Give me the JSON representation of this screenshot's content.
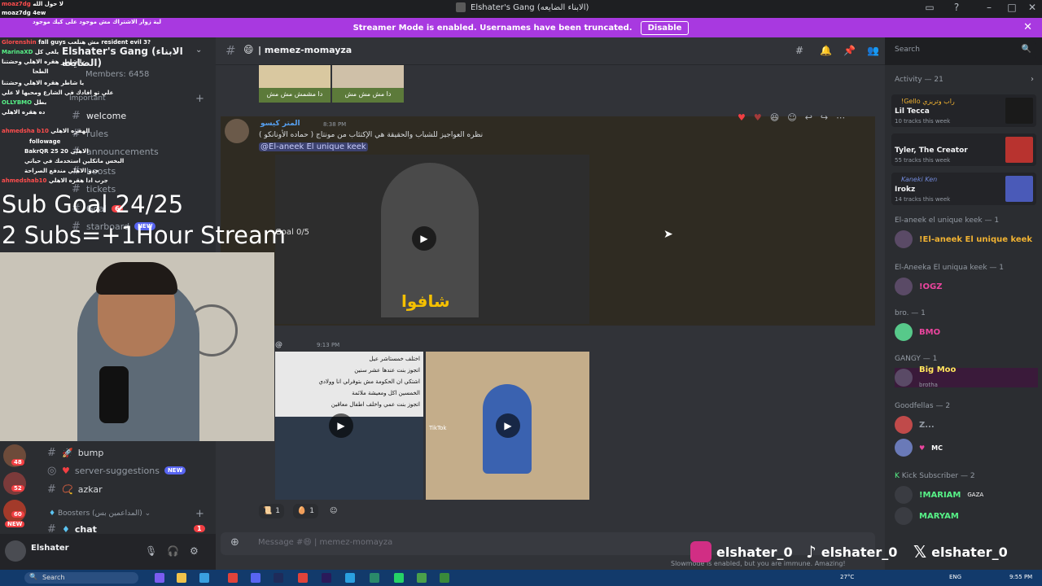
{
  "window": {
    "title": "Elshater's Gang (الابناء الضايعه)"
  },
  "banner": {
    "text": "Streamer Mode is enabled. Usernames have been truncated.",
    "button": "Disable"
  },
  "server": {
    "name": "Elshater's Gang (الابناء الضايعه)",
    "members": "Members: 6458",
    "important": "Important",
    "channels_top": [
      "welcome",
      "rules",
      "announcements",
      "boosts",
      "tickets",
      "Goal",
      "starboard"
    ],
    "new_badge": "NEW",
    "badge_6": "6",
    "channels_bottom": [
      {
        "name": "bump"
      },
      {
        "name": "server-suggestions",
        "badge": "NEW"
      },
      {
        "name": "azkar"
      }
    ],
    "boosters_category": "Boosters (المداعمين بس)",
    "chat_channel": "chat",
    "chat_badge": "1",
    "server_badges": [
      "749",
      "14",
      "48",
      "52",
      "60",
      "NEW"
    ]
  },
  "user": {
    "name": "Elshater"
  },
  "channel": {
    "name": "memez-momayza",
    "emoji": "😄"
  },
  "search": {
    "placeholder": "Search"
  },
  "messages": {
    "top_images": [
      "دا مشمش مش مش",
      "دا مش مش مش"
    ],
    "m1": {
      "author": "المتر كيسو",
      "time": "8:38 PM",
      "text": "نظره العواجيز للشباب والحقيقة هي الإكتئاب من مونتاج ( حماده الأونانكو )",
      "mention": "@El-aneek El unique keek",
      "video_caption": "شافوا",
      "video_overlay": "Goal 0/5"
    },
    "m2": {
      "author": "@",
      "time": "9:13 PM",
      "image1_lines": [
        "اختلف خمستاشر عيل",
        "اتجوز بنت عندها عشر سنين",
        "اشتكي ان الحكومة مش بتوفرلي انا وولادي",
        "الخمسين اكل ومعيشة ملائمة",
        "اتجوز بنت عمي واخلف اطفال معاقين"
      ],
      "image2_label": "TikTok"
    },
    "reactions": [
      {
        "emoji": "📜",
        "count": "1"
      },
      {
        "emoji": "🥚",
        "count": "1"
      }
    ]
  },
  "composer": {
    "placeholder": "Message #😄 | memez-momayza"
  },
  "slow_note": "Slowmode is enabled, but you are immune. Amazing!",
  "activity": {
    "title": "Activity — 21",
    "cards": [
      {
        "n1": "!Gello راب وتريزي",
        "n2": "Lil Tecca",
        "n3": "10 tracks this week"
      },
      {
        "n1": "",
        "n2": "Tyler, The Creator",
        "n3": "55 tracks this week"
      },
      {
        "n1": "Kaneki Ken",
        "n2": "Irokz",
        "n3": "14 tracks this week"
      }
    ],
    "groups": [
      {
        "title": "El-aneek el unique keek — 1",
        "member": "!El-aneek El unique keek",
        "color": "#f0b232"
      },
      {
        "title": "El-Aneeka El uniqua keek — 1",
        "member": "!OGZ",
        "color": "#eb459e"
      },
      {
        "title": "bro. — 1",
        "member": "BMO",
        "color": "#eb459e"
      },
      {
        "title": "GANGY — 1",
        "member": "Big Moo",
        "sub": "brotha",
        "color": "#fee75c"
      },
      {
        "title": "Goodfellas — 2",
        "member": "Z...",
        "sub": "MC",
        "color": "#949ba4"
      },
      {
        "title": "Kick Subscriber — 2",
        "member": "!MARIAM",
        "tag": "GAZA",
        "member2": "MARYAM",
        "color": "#57f287"
      }
    ]
  },
  "overlay": {
    "sub_goal": "Sub Goal 24/25",
    "subs_rule": "2 Subs=+1Hour Stream",
    "chat_lines": [
      {
        "name": "moaz7dg",
        "text": "لا حول الله",
        "color": "#ff4d4d"
      },
      {
        "name": "moaz7dg",
        "text": "4ew",
        "color": "#ffffff"
      },
      {
        "name": "",
        "text": "لية زوار الاشتراك مش موجود على كيك موجود",
        "color": "#ffffff"
      },
      {
        "name": "Glorenshin",
        "text": "fall guys مش هنلعب resident evil 3?",
        "color": "#ff4d4d"
      },
      {
        "name": "MarinaXD",
        "text": "يلغي كل",
        "color": "#57f287"
      },
      {
        "name": "",
        "text": "شعرهم هوة كبيرة",
        "color": "#ffffff"
      },
      {
        "name": "",
        "text": "يا شاطر هقره الاهلي وحشتنا",
        "color": "#ffffff"
      },
      {
        "name": "",
        "text": "الطحا",
        "color": "#ffffff"
      },
      {
        "name": "",
        "text": "يا شاطر هقره الاهلي وحشتنا",
        "color": "#ffffff"
      },
      {
        "name": "",
        "text": "علي تو افادك في الشارع ومحيها لا علي",
        "color": "#ffffff"
      },
      {
        "name": "OLLYBMO",
        "text": "بطل",
        "color": "#57f287"
      },
      {
        "name": "",
        "text": "ده هقره الاهلي",
        "color": "#ffffff"
      },
      {
        "name": "ahmedsha b10",
        "text": "الهقره الاهلي",
        "color": "#ff4d4d"
      },
      {
        "name": "",
        "text": "followage",
        "color": "#ffffff"
      },
      {
        "name": "BakrQR",
        "text": "25 الاهلي 20",
        "color": "#ffffff"
      },
      {
        "name": "",
        "text": "البخس ماتكلين استخدمك في حياتي",
        "color": "#ffffff"
      },
      {
        "name": "",
        "text": "خدو الاهلي مندفع الصراحة",
        "color": "#ffffff"
      },
      {
        "name": "ahmedshab10",
        "text": "جرب ادا هقره الاهلي",
        "color": "#ff4d4d"
      }
    ]
  },
  "socials": [
    {
      "handle": "elshater_0"
    },
    {
      "handle": "elshater_0"
    },
    {
      "handle": "elshater_0"
    }
  ],
  "taskbar": {
    "search": "Search",
    "weather": "27°C",
    "lang": "ENG",
    "time": "9:55 PM"
  }
}
